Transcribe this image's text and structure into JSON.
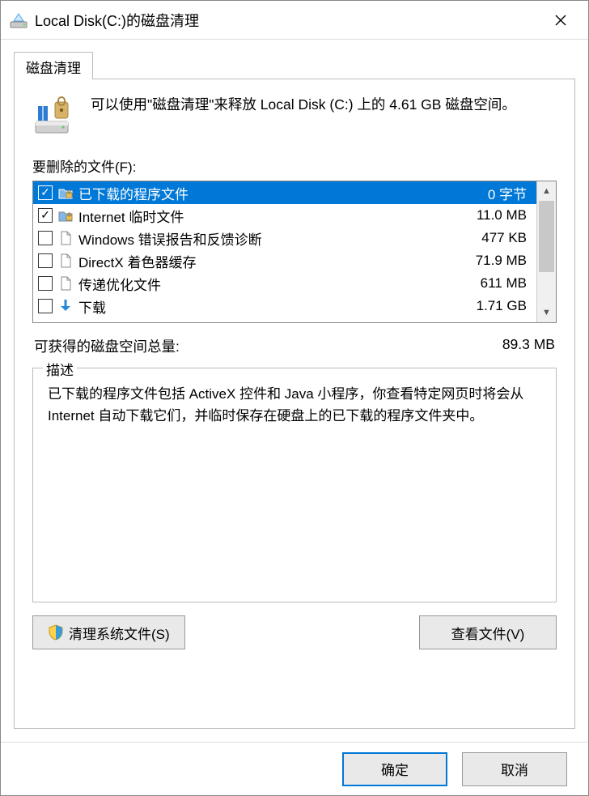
{
  "title": "Local Disk(C:)的磁盘清理",
  "tab_label": "磁盘清理",
  "intro": "可以使用\"磁盘清理\"来释放 Local Disk (C:) 上的 4.61 GB 磁盘空间。",
  "list_label": "要删除的文件(F):",
  "files": [
    {
      "name": "已下载的程序文件",
      "size": "0 字节",
      "checked": true,
      "selected": true,
      "icon": "folder-locked"
    },
    {
      "name": "Internet 临时文件",
      "size": "11.0 MB",
      "checked": true,
      "selected": false,
      "icon": "folder-locked"
    },
    {
      "name": "Windows 错误报告和反馈诊断",
      "size": "477 KB",
      "checked": false,
      "selected": false,
      "icon": "file"
    },
    {
      "name": "DirectX 着色器缓存",
      "size": "71.9 MB",
      "checked": false,
      "selected": false,
      "icon": "file"
    },
    {
      "name": "传递优化文件",
      "size": "611 MB",
      "checked": false,
      "selected": false,
      "icon": "file"
    },
    {
      "name": "下载",
      "size": "1.71 GB",
      "checked": false,
      "selected": false,
      "icon": "download"
    }
  ],
  "total_label": "可获得的磁盘空间总量:",
  "total_value": "89.3 MB",
  "desc_legend": "描述",
  "desc_text": "已下载的程序文件包括 ActiveX 控件和 Java 小程序，你查看特定网页时将会从 Internet 自动下载它们，并临时保存在硬盘上的已下载的程序文件夹中。",
  "btn_clean": "清理系统文件(S)",
  "btn_view": "查看文件(V)",
  "btn_ok": "确定",
  "btn_cancel": "取消"
}
